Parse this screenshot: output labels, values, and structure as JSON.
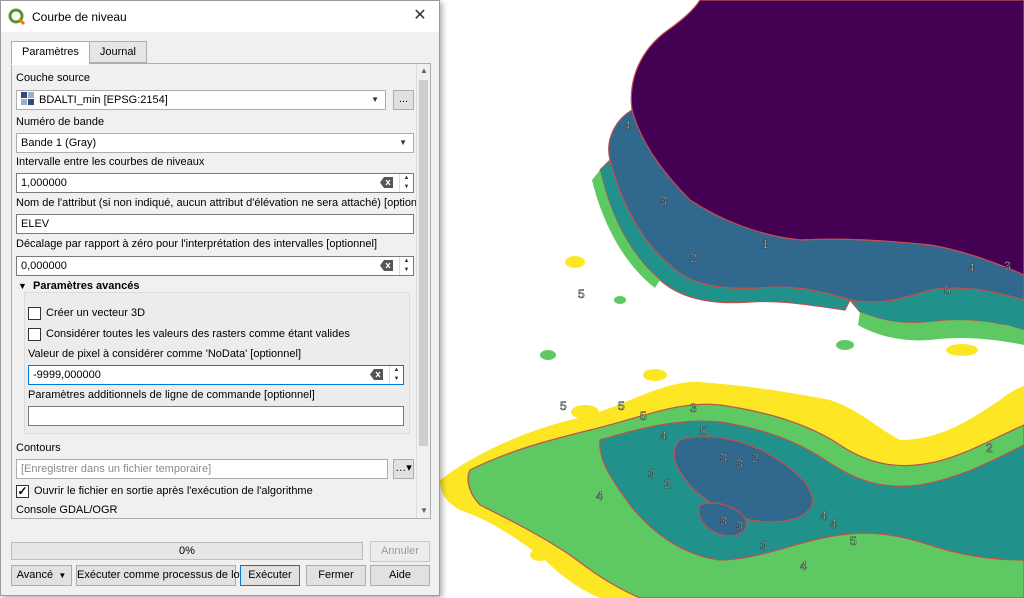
{
  "window": {
    "title": "Courbe de niveau",
    "close_glyph": "✕"
  },
  "tabs": [
    {
      "label": "Paramètres",
      "active": true
    },
    {
      "label": "Journal",
      "active": false
    }
  ],
  "form": {
    "source_label": "Couche source",
    "source_value": "BDALTI_min [EPSG:2154]",
    "browse_label": "...",
    "band_label": "Numéro de bande",
    "band_value": "Bande 1 (Gray)",
    "interval_label": "Intervalle entre les courbes de niveaux",
    "interval_value": "1,000000",
    "attr_label": "Nom de l'attribut (si non indiqué, aucun attribut d'élévation ne sera attaché) [optionnel]",
    "attr_value": "ELEV",
    "offset_label": "Décalage par rapport à zéro pour l'interprétation des intervalles [optionnel]",
    "offset_value": "0,000000",
    "advanced_header": "Paramètres avancés",
    "create_3d_label": "Créer un vecteur 3D",
    "create_3d_checked": false,
    "all_valid_label": "Considérer toutes les valeurs des rasters comme étant valides",
    "all_valid_checked": false,
    "nodata_label": "Valeur de pixel à considérer comme 'NoData' [optionnel]",
    "nodata_value": "-9999,000000",
    "extra_label": "Paramètres additionnels de ligne de commande [optionnel]",
    "extra_value": "",
    "contours_label": "Contours",
    "contours_placeholder": "[Enregistrer dans un fichier temporaire]",
    "open_output_label": "Ouvrir le fichier en sortie après l'exécution de l'algorithme",
    "open_output_checked": true,
    "console_label": "Console GDAL/OGR"
  },
  "progress": {
    "text": "0%",
    "value": 0
  },
  "buttons": {
    "cancel": "Annuler",
    "advanced": "Avancé",
    "batch": "Exécuter comme processus de lot...",
    "run": "Exécuter",
    "close": "Fermer",
    "help": "Aide"
  },
  "map": {
    "colors": {
      "sea_deep": "#440154",
      "contour_line": "#c0504d",
      "level_4": "#31688e",
      "level_3": "#21918c",
      "level_2": "#5ec962",
      "level_1": "#fde725",
      "land": "#ffffff"
    },
    "contour_labels": [
      "5",
      "4",
      "3",
      "2",
      "1",
      "5",
      "4",
      "3",
      "2",
      "5",
      "3",
      "4",
      "5",
      "3",
      "3",
      "2",
      "4",
      "4",
      "5",
      "3",
      "4",
      "3",
      "3",
      "2",
      "5",
      "5",
      "4",
      "3"
    ]
  }
}
